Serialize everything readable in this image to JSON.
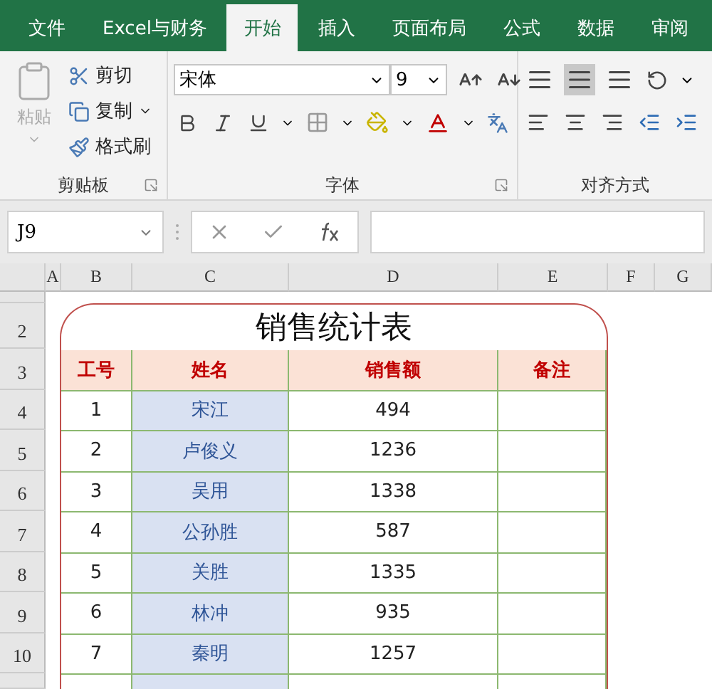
{
  "tabs": [
    {
      "label": "文件",
      "selected": false
    },
    {
      "label": "Excel与财务",
      "selected": false
    },
    {
      "label": "开始",
      "selected": true
    },
    {
      "label": "插入",
      "selected": false
    },
    {
      "label": "页面布局",
      "selected": false
    },
    {
      "label": "公式",
      "selected": false
    },
    {
      "label": "数据",
      "selected": false
    },
    {
      "label": "审阅",
      "selected": false
    }
  ],
  "clipboard": {
    "paste": {
      "label": "粘贴",
      "disabled": true
    },
    "actions": [
      {
        "kind": "cut",
        "label": "剪切"
      },
      {
        "kind": "copy",
        "label": "复制"
      },
      {
        "kind": "brush",
        "label": "格式刷"
      }
    ],
    "label": "剪贴板"
  },
  "font": {
    "name": "宋体",
    "size": "9",
    "label": "字体"
  },
  "alignment": {
    "vertical": [
      {
        "selected": false
      },
      {
        "selected": true
      },
      {
        "selected": false
      }
    ],
    "label": "对齐方式"
  },
  "name_box": "J9",
  "columns": [
    "A",
    "B",
    "C",
    "D",
    "E",
    "F",
    "G"
  ],
  "row_numbers": [
    "2",
    "3",
    "4",
    "5",
    "6",
    "7",
    "8",
    "9",
    "10"
  ],
  "table": {
    "title": "销售统计表",
    "columns": [
      "工号",
      "姓名",
      "销售额",
      "备注"
    ],
    "rows": [
      [
        "1",
        "宋江",
        "494"
      ],
      [
        "2",
        "卢俊义",
        "1236"
      ],
      [
        "3",
        "吴用",
        "1338"
      ],
      [
        "4",
        "公孙胜",
        "587"
      ],
      [
        "5",
        "关胜",
        "1335"
      ],
      [
        "6",
        "林冲",
        "935"
      ],
      [
        "7",
        "秦明",
        "1257"
      ]
    ]
  }
}
